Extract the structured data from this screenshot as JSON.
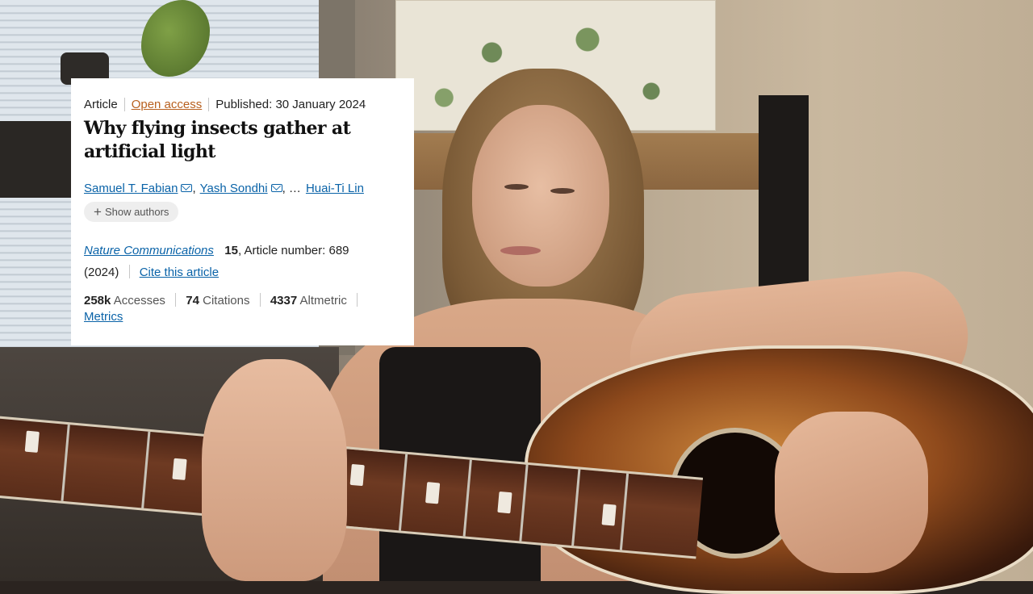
{
  "article": {
    "type": "Article",
    "access": "Open access",
    "published": "Published: 30 January 2024",
    "title": "Why flying insects gather at artificial light",
    "authors": [
      {
        "name": "Samuel T. Fabian"
      },
      {
        "name": "Yash Sondhi"
      },
      {
        "name": "Huai-Ti Lin"
      }
    ],
    "authors_sep": ",",
    "authors_ellipsis": ", …",
    "show_authors": "Show authors",
    "journal": "Nature Communications",
    "volume": "15",
    "article_number": ", Article number: 689",
    "year": "(2024)",
    "cite": "Cite this article",
    "accesses_value": "258k",
    "accesses_label": "Accesses",
    "citations_value": "74",
    "citations_label": "Citations",
    "altmetric_value": "4337",
    "altmetric_label": "Altmetric",
    "metrics_link": "Metrics"
  },
  "colors": {
    "link": "#0a63a8",
    "open_access": "#b8601f",
    "card_background": "#ffffff"
  },
  "icons": [
    "mail-icon",
    "plus-icon"
  ]
}
